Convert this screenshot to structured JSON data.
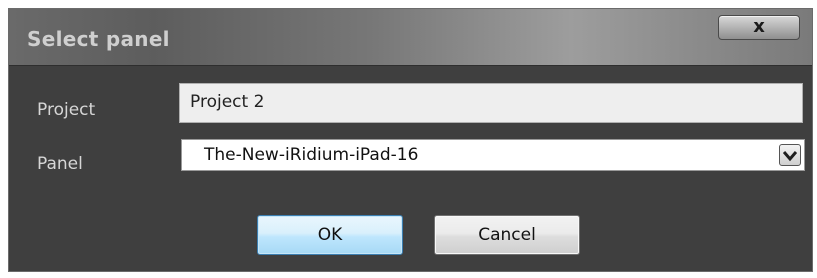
{
  "dialog": {
    "title": "Select panel",
    "close_label": "x"
  },
  "form": {
    "project_label": "Project",
    "project_value": "Project 2",
    "panel_label": "Panel",
    "panel_value": "The-New-iRidium-iPad-16"
  },
  "buttons": {
    "ok_label": "OK",
    "cancel_label": "Cancel"
  },
  "icons": {
    "dropdown": "chevron-down-icon"
  }
}
